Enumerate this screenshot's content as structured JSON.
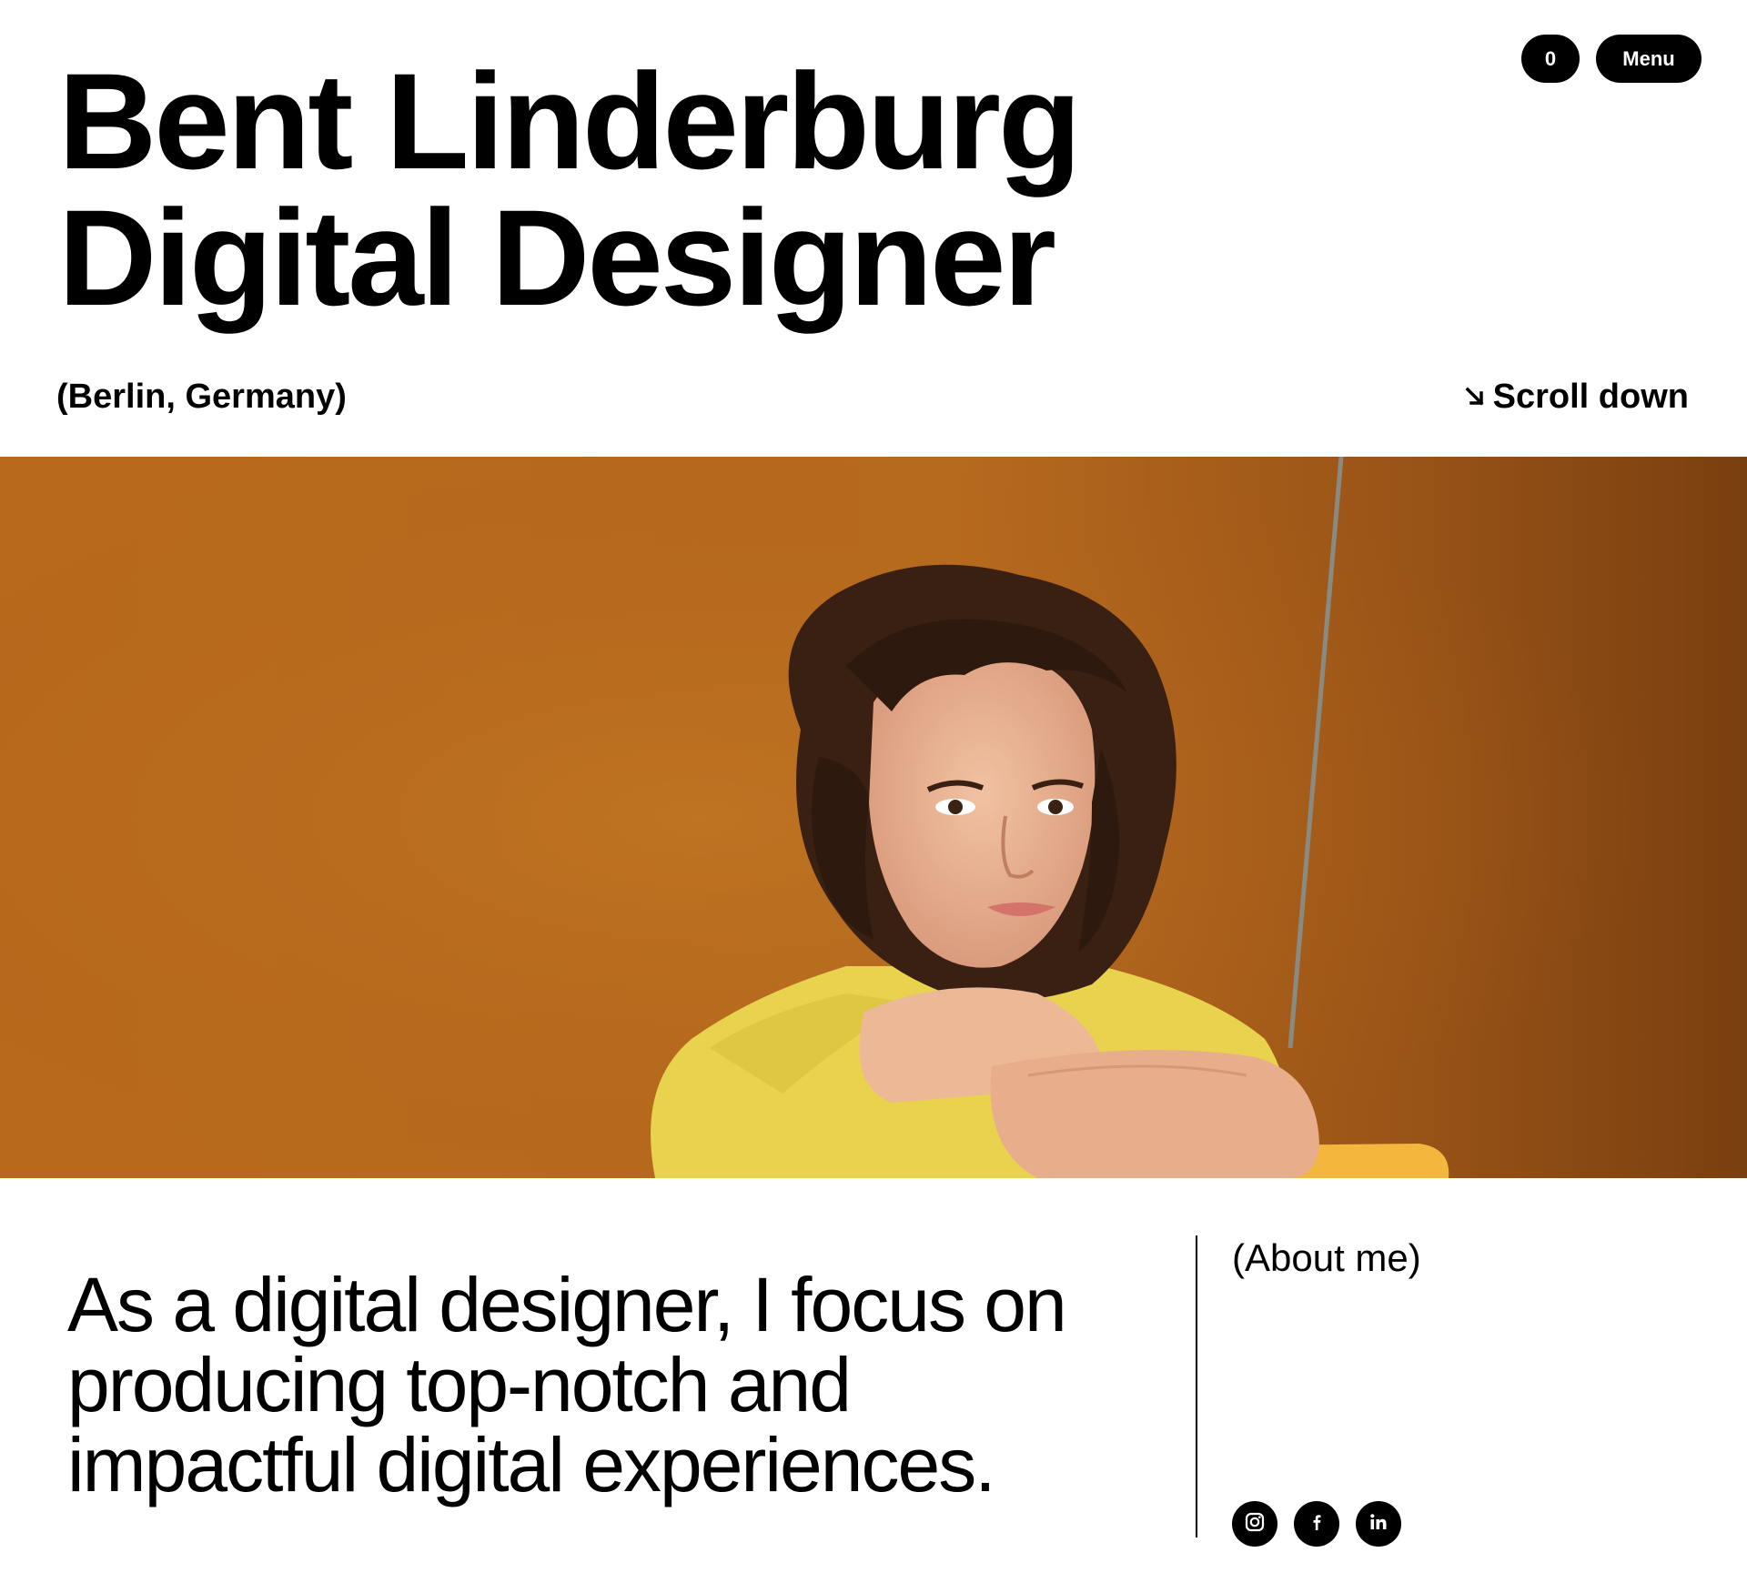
{
  "header": {
    "title_line1": "Bent Linderburg",
    "title_line2": "Digital Designer",
    "cart_count": "0",
    "menu_label": "Menu",
    "location": "(Berlin, Germany)",
    "scroll_label": "Scroll down",
    "scroll_icon": "arrow-down-right-icon"
  },
  "hero_image": {
    "subject": "portrait-photo",
    "background_color": "#b8691d",
    "shirt_color": "#e8d04a"
  },
  "about": {
    "statement": "As a digital designer, I focus on producing top-notch and impactful digital experiences.",
    "label": "(About me)",
    "socials": [
      {
        "icon": "instagram-icon"
      },
      {
        "icon": "facebook-icon"
      },
      {
        "icon": "linkedin-icon"
      }
    ]
  }
}
